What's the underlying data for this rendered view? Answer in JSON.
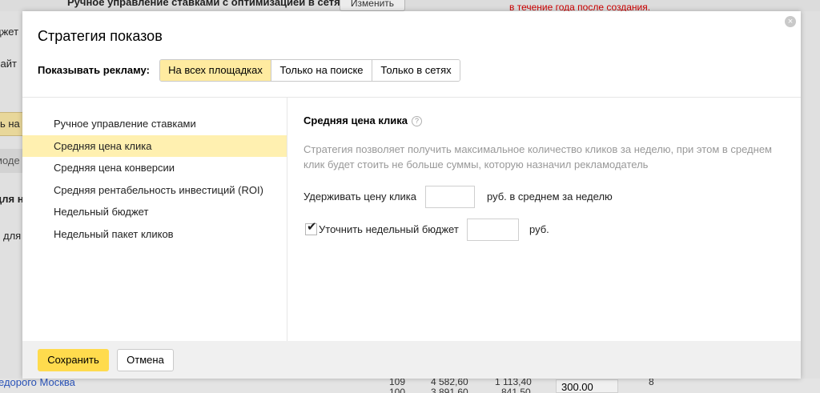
{
  "background": {
    "top_strategy_text": "Ручное управление ставками с оптимизацией в сетях",
    "top_button": "Изменить",
    "top_red_note": "в течение года после создания.",
    "left_fragments": [
      "джет",
      "сайт",
      "ть на",
      "моде",
      "для н",
      "для"
    ],
    "bottom_link": "едорого Москва",
    "bottom_cells": [
      "109",
      "4 582,60",
      "1 113,40",
      "100",
      "3 891,60",
      "841,50",
      "8"
    ],
    "bottom_box_value": "300.00"
  },
  "modal": {
    "title": "Стратегия показов",
    "close_label": "×",
    "show_ads_label": "Показывать рекламу:",
    "placement_tabs": [
      "На всех площадках",
      "Только на поиске",
      "Только в сетях"
    ],
    "strategies": [
      "Ручное управление ставками",
      "Средняя цена клика",
      "Средняя цена конверсии",
      "Средняя рентабельность инвестиций (ROI)",
      "Недельный бюджет",
      "Недельный пакет кликов"
    ],
    "detail": {
      "title": "Средняя цена клика",
      "help_icon": "?",
      "description": "Стратегия позволяет получить максимальное количество кликов за неделю, при этом в среднем клик будет стоить не больше суммы, которую назначил рекламодатель",
      "hold_price_label": "Удерживать цену клика",
      "hold_price_value": "",
      "hold_price_unit": "руб. в среднем за неделю",
      "refine_budget_label": "Уточнить недельный бюджет",
      "refine_budget_checked": true,
      "refine_budget_value": "",
      "refine_budget_unit": "руб."
    },
    "footer": {
      "save_label": "Сохранить",
      "cancel_label": "Отмена"
    }
  },
  "colors": {
    "accent_yellow": "#ffdb4d",
    "selected_tab": "#ffeba0",
    "selected_item": "#fff0b0",
    "muted_text": "#999999",
    "red_note": "#cc0000"
  }
}
